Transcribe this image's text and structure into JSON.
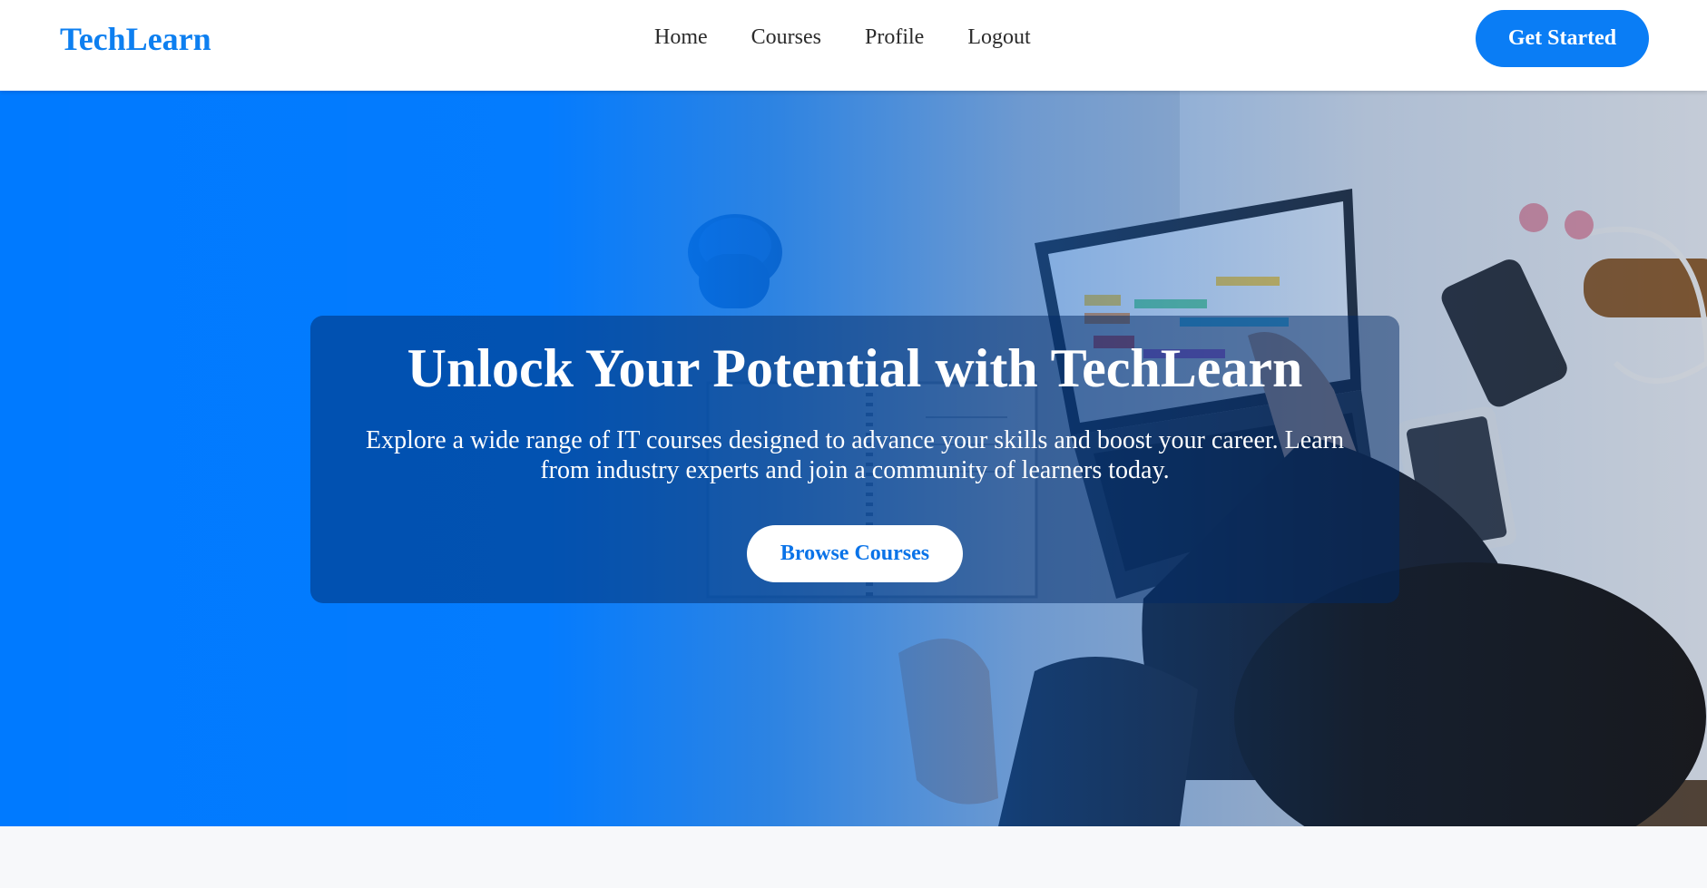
{
  "brand": {
    "name": "TechLearn",
    "color": "#0d7ff0"
  },
  "nav": {
    "links": [
      "Home",
      "Courses",
      "Profile",
      "Logout"
    ],
    "cta_label": "Get Started"
  },
  "hero": {
    "title": "Unlock Your Potential with TechLearn",
    "subtitle": "Explore a wide range of IT courses designed to advance your skills and boost your career. Learn from industry experts and join a community of learners today.",
    "button_label": "Browse Courses",
    "image": "overhead-workspace-laptop-photo"
  },
  "colors": {
    "primary": "#0a7df5",
    "gradient_start": "#007aff",
    "page_background": "#f7f8fa"
  }
}
